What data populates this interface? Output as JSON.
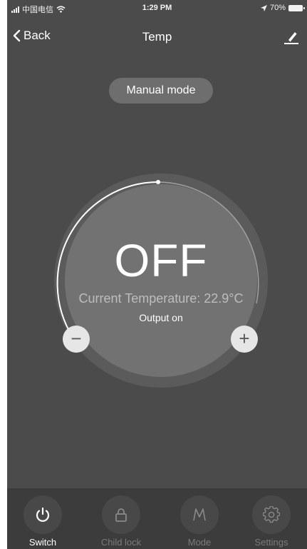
{
  "status_bar": {
    "carrier": "中国电信",
    "time": "1:29 PM",
    "battery": "70%"
  },
  "nav": {
    "back_label": "Back",
    "title": "Temp"
  },
  "mode": {
    "label": "Manual mode"
  },
  "dial": {
    "power_state": "OFF",
    "current_temperature": "Current Temperature: 22.9°C",
    "output_status": "Output on",
    "minus_symbol": "−",
    "plus_symbol": "+"
  },
  "tabs": [
    {
      "label": "Switch",
      "icon": "power-icon",
      "active": true
    },
    {
      "label": "Child lock",
      "icon": "lock-icon",
      "active": false
    },
    {
      "label": "Mode",
      "icon": "mode-m-icon",
      "active": false
    },
    {
      "label": "Settings",
      "icon": "gear-icon",
      "active": false
    }
  ],
  "colors": {
    "background": "#4b4b4b",
    "tab_bar": "#3c3c3c",
    "text_primary": "#ffffff",
    "text_muted": "#7a7a7a"
  }
}
